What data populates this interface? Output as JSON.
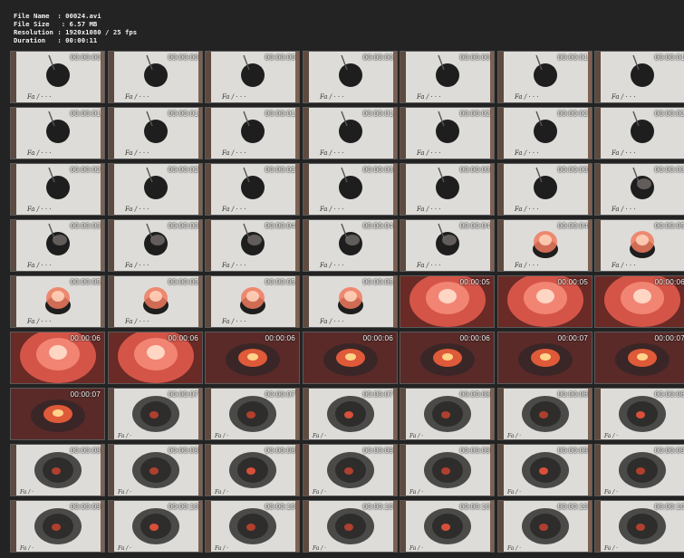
{
  "file_info": {
    "file_name_label": "File Name",
    "file_name": "00024.avi",
    "file_size_label": "File Size",
    "file_size": "6.57 MB",
    "resolution_label": "Resolution",
    "resolution": "1920x1080 / 25 fps",
    "duration_label": "Duration",
    "duration": "00:00:11"
  },
  "grid": {
    "columns": 7,
    "rows": 9
  },
  "frames": [
    {
      "time": "00:00:00",
      "scene": "plate"
    },
    {
      "time": "00:00:00",
      "scene": "plate"
    },
    {
      "time": "00:00:00",
      "scene": "plate"
    },
    {
      "time": "00:00:00",
      "scene": "plate"
    },
    {
      "time": "00:00:00",
      "scene": "plate"
    },
    {
      "time": "00:00:01",
      "scene": "plate"
    },
    {
      "time": "00:00:01",
      "scene": "plate"
    },
    {
      "time": "00:00:01",
      "scene": "plate"
    },
    {
      "time": "00:00:01",
      "scene": "plate"
    },
    {
      "time": "00:00:01",
      "scene": "plate"
    },
    {
      "time": "00:00:01",
      "scene": "plate"
    },
    {
      "time": "00:00:02",
      "scene": "plate"
    },
    {
      "time": "00:00:02",
      "scene": "plate"
    },
    {
      "time": "00:00:02",
      "scene": "plate"
    },
    {
      "time": "00:00:02",
      "scene": "plate"
    },
    {
      "time": "00:00:02",
      "scene": "plate"
    },
    {
      "time": "00:00:02",
      "scene": "plate"
    },
    {
      "time": "00:00:03",
      "scene": "plate"
    },
    {
      "time": "00:00:03",
      "scene": "plate"
    },
    {
      "time": "00:00:03",
      "scene": "plate"
    },
    {
      "time": "00:00:03",
      "scene": "smoke"
    },
    {
      "time": "00:00:03",
      "scene": "smoke"
    },
    {
      "time": "00:00:03",
      "scene": "smoke"
    },
    {
      "time": "00:00:04",
      "scene": "smoke"
    },
    {
      "time": "00:00:04",
      "scene": "smoke"
    },
    {
      "time": "00:00:04",
      "scene": "smoke"
    },
    {
      "time": "00:00:04",
      "scene": "glow"
    },
    {
      "time": "00:00:05",
      "scene": "glow"
    },
    {
      "time": "00:00:05",
      "scene": "glow"
    },
    {
      "time": "00:00:05",
      "scene": "glow"
    },
    {
      "time": "00:00:05",
      "scene": "glow"
    },
    {
      "time": "00:00:05",
      "scene": "glow"
    },
    {
      "time": "00:00:05",
      "scene": "fire"
    },
    {
      "time": "00:00:05",
      "scene": "fire"
    },
    {
      "time": "00:00:06",
      "scene": "fire"
    },
    {
      "time": "00:00:06",
      "scene": "fire"
    },
    {
      "time": "00:00:06",
      "scene": "fire"
    },
    {
      "time": "00:00:06",
      "scene": "burst"
    },
    {
      "time": "00:00:06",
      "scene": "burst"
    },
    {
      "time": "00:00:06",
      "scene": "burst"
    },
    {
      "time": "00:00:07",
      "scene": "burst"
    },
    {
      "time": "00:00:07",
      "scene": "burst"
    },
    {
      "time": "00:00:07",
      "scene": "burst"
    },
    {
      "time": "00:00:07",
      "scene": "ash"
    },
    {
      "time": "00:00:07",
      "scene": "ash"
    },
    {
      "time": "00:00:07",
      "scene": "ash"
    },
    {
      "time": "00:00:08",
      "scene": "ash"
    },
    {
      "time": "00:00:08",
      "scene": "ash"
    },
    {
      "time": "00:00:08",
      "scene": "ash"
    },
    {
      "time": "00:00:08",
      "scene": "ash"
    },
    {
      "time": "00:00:08",
      "scene": "ash"
    },
    {
      "time": "00:00:08",
      "scene": "ash"
    },
    {
      "time": "00:00:09",
      "scene": "ash"
    },
    {
      "time": "00:00:09",
      "scene": "ash"
    },
    {
      "time": "00:00:09",
      "scene": "ash"
    },
    {
      "time": "00:00:09",
      "scene": "ash"
    },
    {
      "time": "00:00:09",
      "scene": "ash"
    },
    {
      "time": "00:00:10",
      "scene": "ash"
    },
    {
      "time": "00:00:10",
      "scene": "ash"
    },
    {
      "time": "00:00:10",
      "scene": "ash"
    },
    {
      "time": "00:00:10",
      "scene": "ash"
    },
    {
      "time": "00:00:10",
      "scene": "ash"
    },
    {
      "time": "00:00:10",
      "scene": "ash"
    }
  ],
  "colors": {
    "background": "#232323",
    "text": "#f0f0f0",
    "paper": "#dcdad6",
    "table": "#7a5a45",
    "powder": "#1f1f1f",
    "fire": "#f0705a"
  }
}
